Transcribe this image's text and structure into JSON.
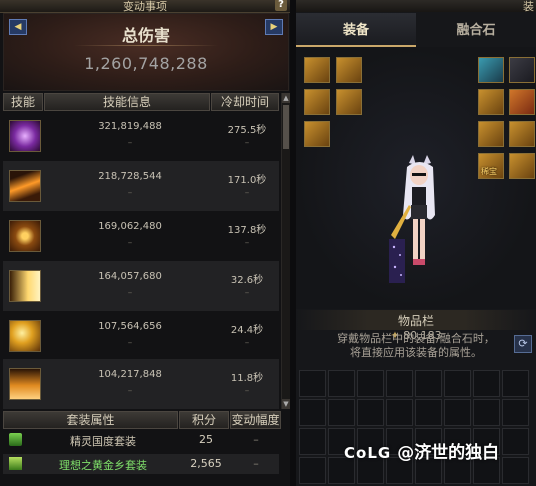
{
  "left_panel": {
    "title": "变动事项",
    "help": "?",
    "damage": {
      "title": "总伤害",
      "value": "1,260,748,288",
      "prev_arrow": "◀",
      "next_arrow": "▶"
    },
    "headers": {
      "skill": "技能",
      "info": "技能信息",
      "cooldown": "冷却时间"
    },
    "skills": [
      {
        "icon": "purple-burst-skill-icon",
        "damage": "321,819,488",
        "cooldown": "275.5秒",
        "dash1": "–",
        "dash2": "–"
      },
      {
        "icon": "orange-slash-skill-icon",
        "damage": "218,728,544",
        "cooldown": "171.0秒",
        "dash1": "–",
        "dash2": "–"
      },
      {
        "icon": "star-emblem-skill-icon",
        "damage": "169,062,480",
        "cooldown": "137.8秒",
        "dash1": "–",
        "dash2": "–"
      },
      {
        "icon": "golden-rays-skill-icon",
        "damage": "164,057,680",
        "cooldown": "32.6秒",
        "dash1": "–",
        "dash2": "–"
      },
      {
        "icon": "sparkle-skill-icon",
        "damage": "107,564,656",
        "cooldown": "24.4秒",
        "dash1": "–",
        "dash2": "–"
      },
      {
        "icon": "flame-crown-skill-icon",
        "damage": "104,217,848",
        "cooldown": "11.8秒",
        "dash1": "–",
        "dash2": "–"
      }
    ],
    "set_headers": {
      "name": "套装属性",
      "score": "积分",
      "change": "变动幅度"
    },
    "sets": [
      {
        "icon": "green-book-icon",
        "name": "精灵国度套装",
        "score": "25",
        "change": "–",
        "color": "#cfc7b4"
      },
      {
        "icon": "green-tree-icon",
        "name": "理想之黄金乡套装",
        "score": "2,565",
        "change": "–",
        "color": "#7fe06a"
      }
    ]
  },
  "right_panel": {
    "title": "装",
    "tabs": {
      "equip": "装备",
      "stone": "融合石"
    },
    "power": "80,183",
    "power_icon": "crest-icon",
    "refresh_icon": "refresh-icon",
    "inventory_title": "物品栏",
    "inventory_hint_1": "穿戴物品栏中的装备/融合石时，",
    "inventory_hint_2": "将直接应用该装备的属性。",
    "rare_badge": "稀宝"
  },
  "watermark": {
    "logo": "CoLG",
    "text": "@济世的独白"
  }
}
